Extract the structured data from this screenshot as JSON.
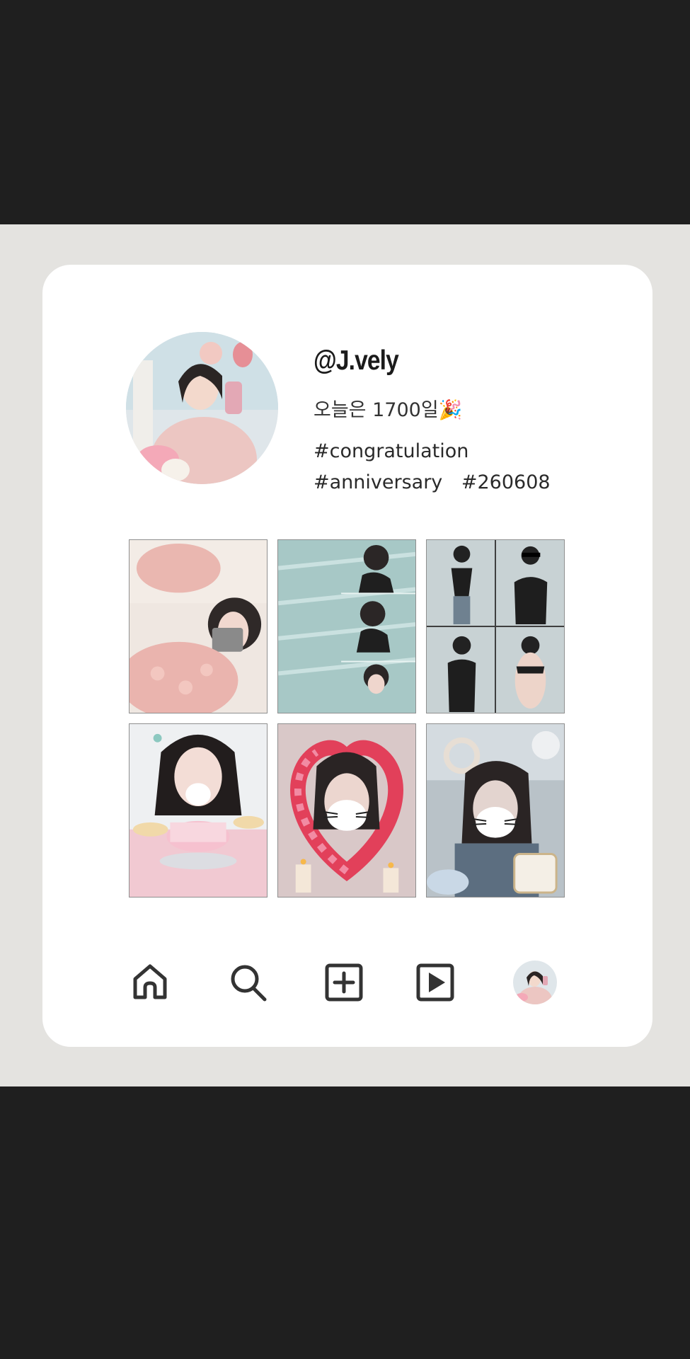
{
  "profile": {
    "username": "@J.vely",
    "bio": "오늘은 1700일🎉",
    "hashtags": [
      "#congratulation",
      "#anniversary",
      "#260608"
    ]
  },
  "grid": {
    "tiles": [
      {
        "name": "roses-selfie-photo"
      },
      {
        "name": "pool-photo"
      },
      {
        "name": "black-top-photos"
      },
      {
        "name": "cake-photo"
      },
      {
        "name": "rose-heart-photo"
      },
      {
        "name": "two-hearts-photo"
      }
    ]
  },
  "bottom_nav": {
    "items": [
      "home-icon",
      "search-icon",
      "add-post-icon",
      "reels-icon",
      "profile-avatar"
    ]
  },
  "colors": {
    "background": "#1f1f1f",
    "band": "#e4e3e0",
    "card": "#ffffff",
    "icon": "#333333"
  }
}
